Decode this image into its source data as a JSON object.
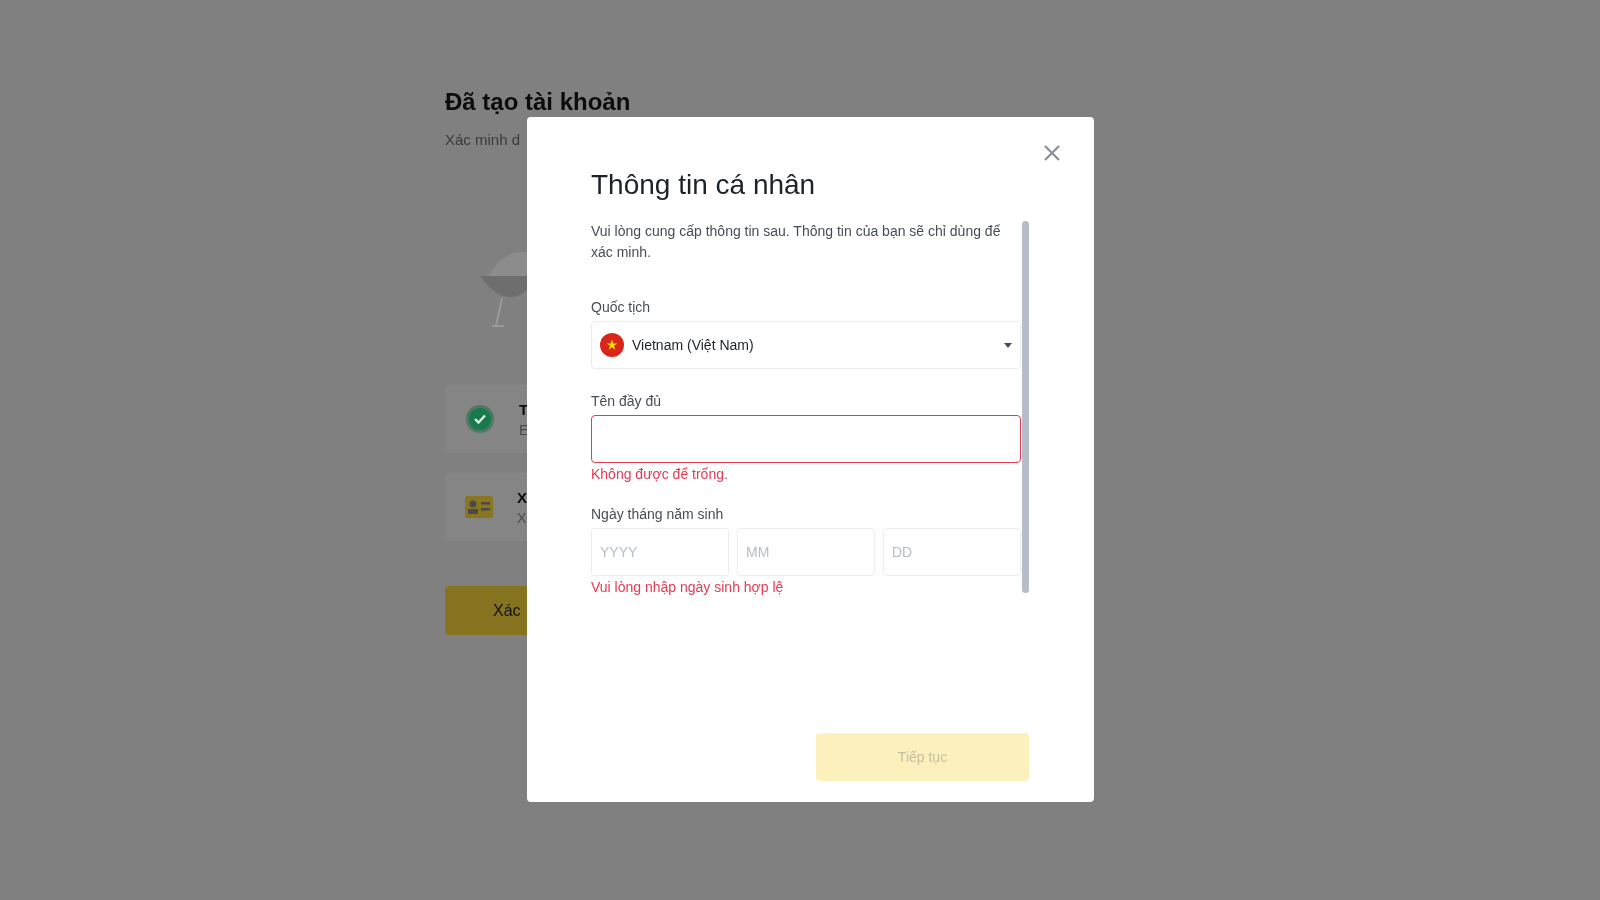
{
  "background": {
    "title": "Đã tạo tài khoản",
    "subtitle": "Xác minh d",
    "cards": [
      {
        "kind": "done",
        "title": "T",
        "sub": "E"
      },
      {
        "kind": "id",
        "title": "X",
        "sub": "X"
      }
    ],
    "button": "Xác"
  },
  "modal": {
    "title": "Thông tin cá nhân",
    "intro": "Vui lòng cung cấp thông tin sau. Thông tin của bạn sẽ chỉ dùng để xác minh.",
    "nationality": {
      "label": "Quốc tịch",
      "value": "Vietnam (Việt Nam)"
    },
    "full_name": {
      "label": "Tên đầy đủ",
      "invalid": true,
      "error": "Không được để trống."
    },
    "birth_date": {
      "label": "Ngày tháng năm sinh",
      "fields": [
        {
          "placeholder": "YYYY"
        },
        {
          "placeholder": "MM"
        },
        {
          "placeholder": "DD"
        }
      ],
      "error": "Vui lòng nhập ngày sinh hợp lệ"
    },
    "button": {
      "label": "Tiếp tục",
      "disabled": true
    }
  }
}
